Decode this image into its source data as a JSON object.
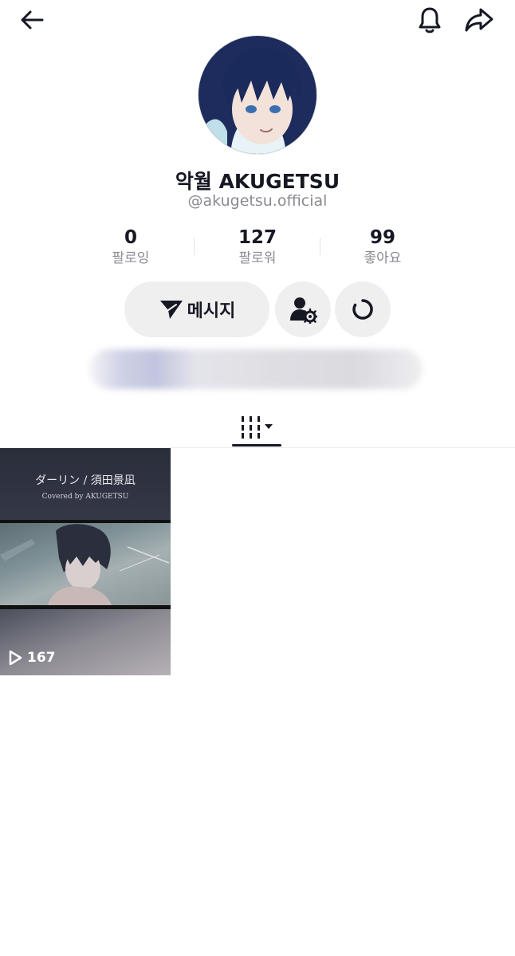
{
  "profile": {
    "display_name": "악월 AKUGETSU",
    "handle": "@akugetsu.official"
  },
  "stats": [
    {
      "value": "0",
      "label": "팔로잉"
    },
    {
      "value": "127",
      "label": "팔로워"
    },
    {
      "value": "99",
      "label": "좋아요"
    }
  ],
  "actions": {
    "message_label": "메시지"
  },
  "videos": [
    {
      "title": "ダーリン / 須田景凪",
      "subtitle": "Covered by AKUGETSU",
      "plays": "167"
    }
  ],
  "icons": {
    "back": "arrow-left-icon",
    "notifications": "bell-icon",
    "share": "share-arrow-icon",
    "message": "send-icon",
    "manage": "user-settings-icon",
    "refresh": "refresh-icon",
    "grid": "grid-tab-icon",
    "play": "play-icon"
  }
}
